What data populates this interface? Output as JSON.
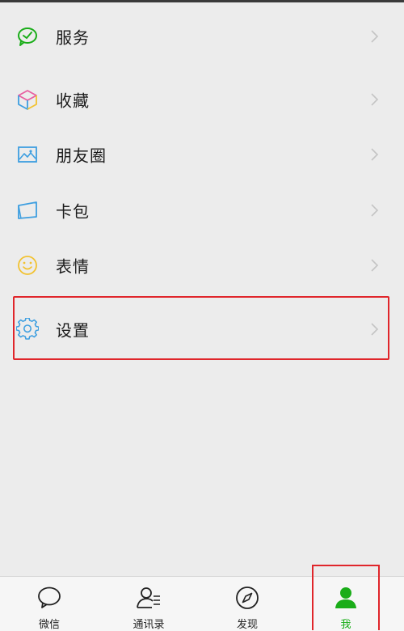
{
  "menu": {
    "items": [
      {
        "id": "services",
        "label": "服务",
        "icon": "checkmark-bubble-icon"
      },
      {
        "id": "favorites",
        "label": "收藏",
        "icon": "cube-icon"
      },
      {
        "id": "moments",
        "label": "朋友圈",
        "icon": "picture-icon"
      },
      {
        "id": "cards",
        "label": "卡包",
        "icon": "card-icon"
      },
      {
        "id": "stickers",
        "label": "表情",
        "icon": "smile-icon"
      },
      {
        "id": "settings",
        "label": "设置",
        "icon": "gear-icon"
      }
    ]
  },
  "tabbar": {
    "tabs": [
      {
        "id": "chats",
        "label": "微信",
        "icon": "chat-bubble-icon"
      },
      {
        "id": "contacts",
        "label": "通讯录",
        "icon": "contacts-icon"
      },
      {
        "id": "discover",
        "label": "发现",
        "icon": "compass-icon"
      },
      {
        "id": "me",
        "label": "我",
        "icon": "person-icon",
        "active": true
      }
    ]
  },
  "colors": {
    "accent": "#1aad19",
    "highlight": "#e0262b",
    "background": "#ececec"
  }
}
